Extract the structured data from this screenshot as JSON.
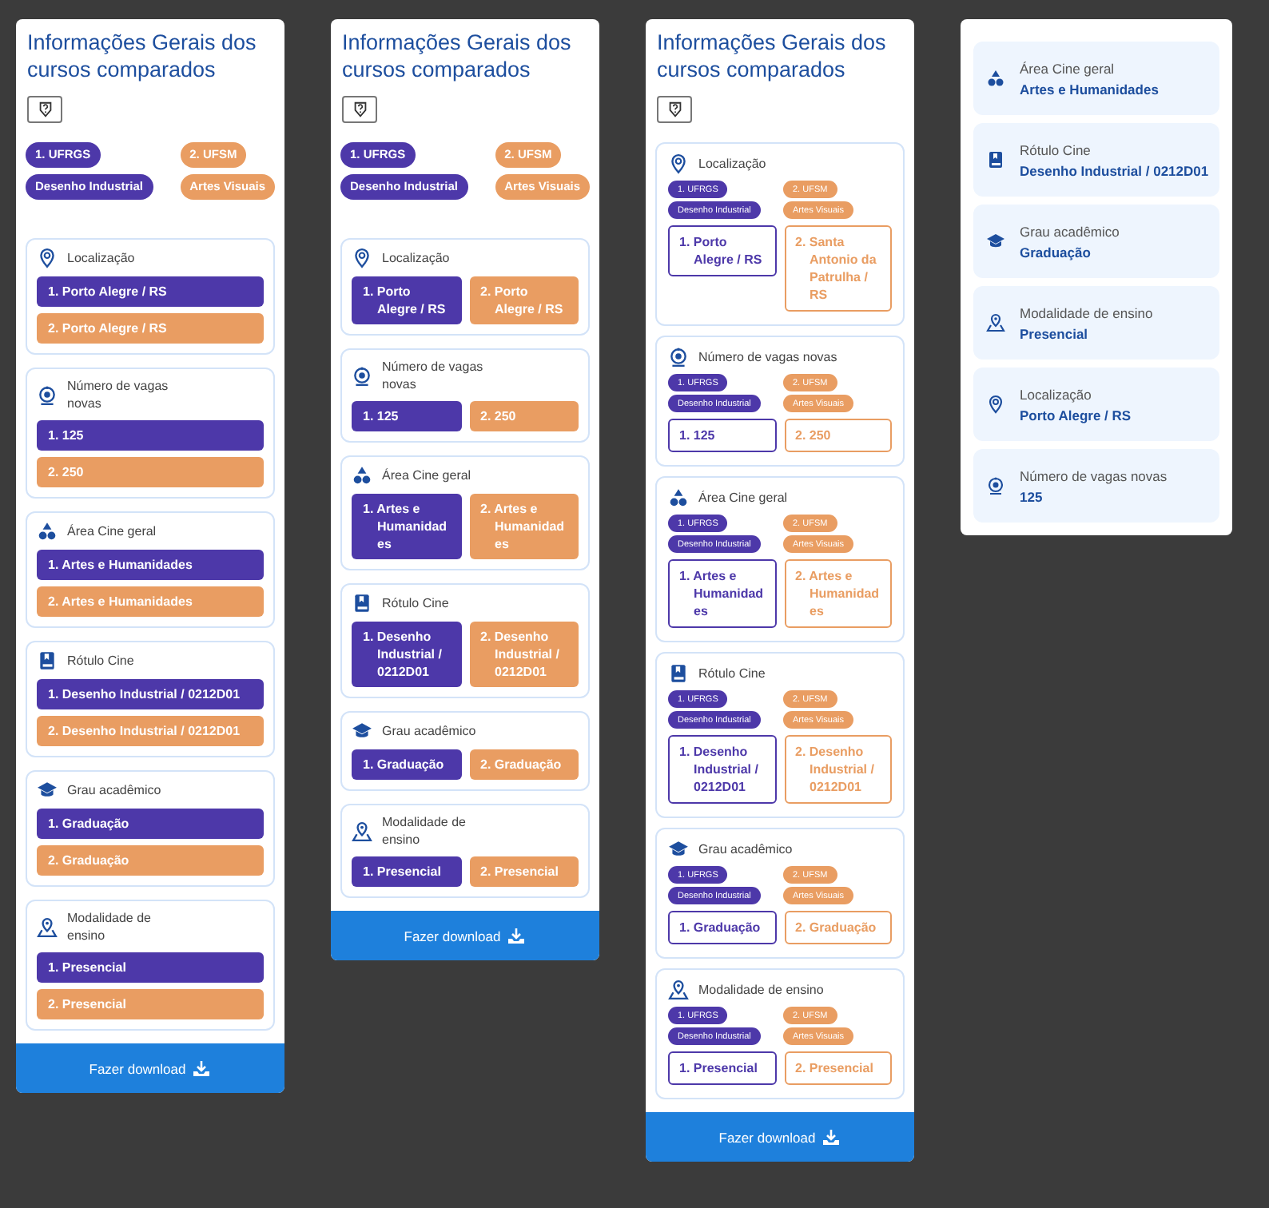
{
  "panels": [
    {
      "kind": "stacked",
      "title": "Informações Gerais dos cursos comparados",
      "courses": [
        {
          "institution": "1. UFRGS",
          "course": "Desenho Industrial",
          "color": "#4d38a9"
        },
        {
          "institution": "2. UFSM",
          "course": "Artes Visuais",
          "color": "#e99d62"
        }
      ],
      "sections": [
        {
          "kind": "pin",
          "label": "Localização",
          "values": [
            "1. Porto Alegre / RS",
            "2. Porto Alegre / RS"
          ]
        },
        {
          "kind": "webcam",
          "label": "Número de vagas novas",
          "values": [
            "1. 125",
            "2. 250"
          ]
        },
        {
          "kind": "shapes",
          "label": "Área Cine geral",
          "values": [
            "1. Artes e Humanidades",
            "2. Artes e Humanidades"
          ]
        },
        {
          "kind": "book",
          "label": "Rótulo Cine",
          "values": [
            "1. Desenho Industrial / 0212D01",
            "2. Desenho Industrial / 0212D01"
          ]
        },
        {
          "kind": "cap",
          "label": "Grau acadêmico",
          "values": [
            "1. Graduação",
            "2. Graduação"
          ]
        },
        {
          "kind": "mappin",
          "label": "Modalidade de ensino",
          "values": [
            "1. Presencial",
            "2. Presencial"
          ]
        }
      ],
      "download": "Fazer download"
    },
    {
      "kind": "side",
      "title": "Informações Gerais dos cursos comparados",
      "courses": [
        {
          "institution": "1. UFRGS",
          "course": "Desenho Industrial",
          "color": "#4d38a9"
        },
        {
          "institution": "2. UFSM",
          "course": "Artes Visuais",
          "color": "#e99d62"
        }
      ],
      "sections": [
        {
          "kind": "pin",
          "label": "Localização",
          "values": [
            "1. Porto Alegre / RS",
            "2. Porto Alegre / RS"
          ]
        },
        {
          "kind": "webcam",
          "label": "Número de vagas novas",
          "values": [
            "1. 125",
            "2. 250"
          ]
        },
        {
          "kind": "shapes",
          "label": "Área Cine geral",
          "values": [
            "1. Artes e Humanidades",
            "2. Artes e Humanidades"
          ]
        },
        {
          "kind": "book",
          "label": "Rótulo Cine",
          "values": [
            "1. Desenho Industrial / 0212D01",
            "2. Desenho Industrial / 0212D01"
          ]
        },
        {
          "kind": "cap",
          "label": "Grau acadêmico",
          "values": [
            "1. Graduação",
            "2. Graduação"
          ]
        },
        {
          "kind": "mappin",
          "label": "Modalidade de ensino",
          "values": [
            "1. Presencial",
            "2. Presencial"
          ]
        }
      ],
      "download": "Fazer download"
    },
    {
      "kind": "outlined",
      "title": "Informações Gerais dos cursos comparados",
      "sections": [
        {
          "kind": "pin",
          "label": "Localização",
          "courses": [
            {
              "institution": "1. UFRGS",
              "course": "Desenho Industrial",
              "color": "#4d38a9"
            },
            {
              "institution": "2. UFSM",
              "course": "Artes Visuais",
              "color": "#e99d62"
            }
          ],
          "values": [
            "1. Porto Alegre / RS",
            "2. Santa Antonio da Patrulha / RS"
          ]
        },
        {
          "kind": "webcam",
          "label": "Número de vagas novas",
          "courses": [
            {
              "institution": "1. UFRGS",
              "course": "Desenho Industrial",
              "color": "#4d38a9"
            },
            {
              "institution": "2. UFSM",
              "course": "Artes Visuais",
              "color": "#e99d62"
            }
          ],
          "values": [
            "1. 125",
            "2. 250"
          ]
        },
        {
          "kind": "shapes",
          "label": "Área Cine geral",
          "courses": [
            {
              "institution": "1. UFRGS",
              "course": "Desenho Industrial",
              "color": "#4d38a9"
            },
            {
              "institution": "2. UFSM",
              "course": "Artes Visuais",
              "color": "#e99d62"
            }
          ],
          "values": [
            "1. Artes e Humanidades",
            "2. Artes e Humanidades"
          ]
        },
        {
          "kind": "book",
          "label": "Rótulo Cine",
          "courses": [
            {
              "institution": "1. UFRGS",
              "course": "Desenho Industrial",
              "color": "#4d38a9"
            },
            {
              "institution": "2. UFSM",
              "course": "Artes Visuais",
              "color": "#e99d62"
            }
          ],
          "values": [
            "1. Desenho Industrial / 0212D01",
            "2. Desenho Industrial / 0212D01"
          ]
        },
        {
          "kind": "cap",
          "label": "Grau acadêmico",
          "courses": [
            {
              "institution": "1. UFRGS",
              "course": "Desenho Industrial",
              "color": "#4d38a9"
            },
            {
              "institution": "2. UFSM",
              "course": "Artes Visuais",
              "color": "#e99d62"
            }
          ],
          "values": [
            "1. Graduação",
            "2. Graduação"
          ]
        },
        {
          "kind": "mappin",
          "label": "Modalidade de ensino",
          "courses": [
            {
              "institution": "1. UFRGS",
              "course": "Desenho Industrial",
              "color": "#4d38a9"
            },
            {
              "institution": "2. UFSM",
              "course": "Artes Visuais",
              "color": "#e99d62"
            }
          ],
          "values": [
            "1. Presencial",
            "2. Presencial"
          ]
        }
      ],
      "download": "Fazer download"
    },
    {
      "kind": "cards",
      "items": [
        {
          "kind": "shapes",
          "label": "Área Cine geral",
          "value": "Artes e Humanidades"
        },
        {
          "kind": "book",
          "label": "Rótulo Cine",
          "value": "Desenho Industrial / 0212D01"
        },
        {
          "kind": "cap",
          "label": "Grau acadêmico",
          "value": "Graduação"
        },
        {
          "kind": "mappin",
          "label": "Modalidade de ensino",
          "value": "Presencial"
        },
        {
          "kind": "pin",
          "label": "Localização",
          "value": "Porto Alegre / RS"
        },
        {
          "kind": "webcam",
          "label": "Número de vagas novas",
          "value": "125"
        }
      ]
    }
  ]
}
